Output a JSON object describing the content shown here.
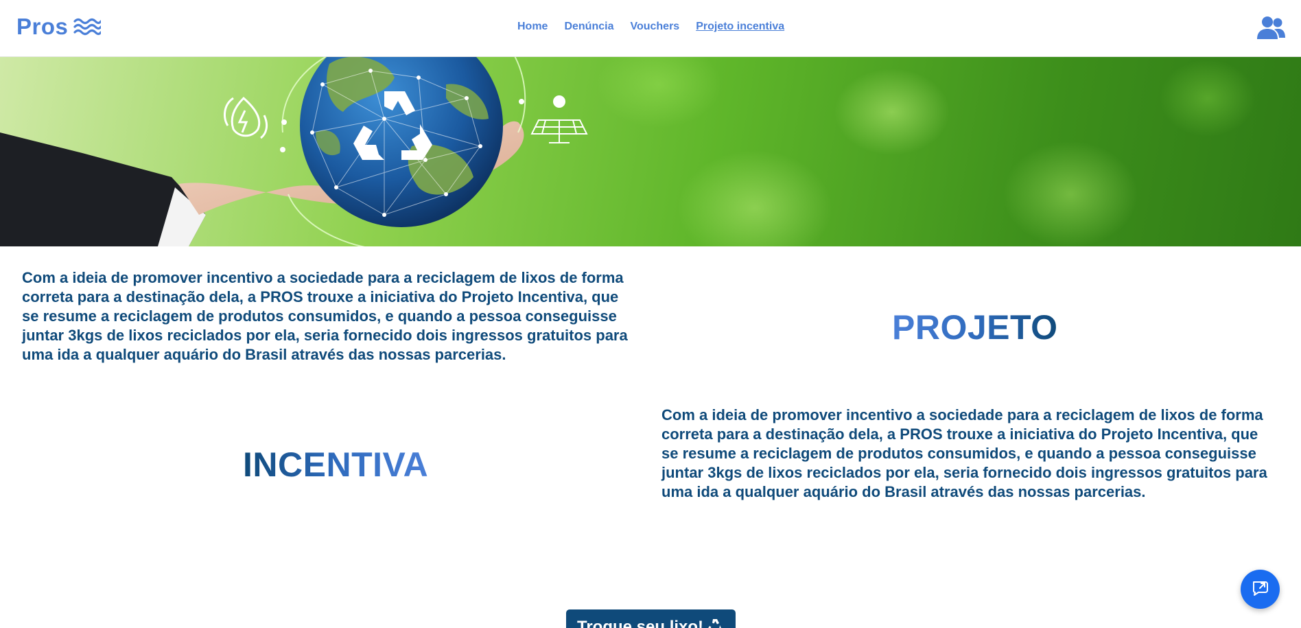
{
  "header": {
    "logo_text": "Pros",
    "logo_icon": "waves-icon",
    "nav": [
      {
        "label": "Home",
        "active": false
      },
      {
        "label": "Denúncia",
        "active": false
      },
      {
        "label": "Vouchers",
        "active": false
      },
      {
        "label": "Projeto incentiva",
        "active": true
      }
    ],
    "account_icon": "users-icon"
  },
  "hero": {
    "image_description_icons": [
      "recycle-icon",
      "energy-drop-icon",
      "solar-panel-icon"
    ]
  },
  "content": {
    "paragraph_left": "Com a ideia de promover incentivo a sociedade para a reciclagem de lixos de forma correta para a destinação dela, a PROS trouxe a iniciativa do Projeto Incentiva, que se resume a reciclagem de produtos consumidos, e quando a pessoa conseguisse juntar 3kgs de lixos reciclados por ela, seria fornecido dois ingressos gratuitos para uma ida a qualquer aquário do Brasil através das nossas parcerias.",
    "word_right": "PROJETO",
    "paragraph_right": "Com a ideia de promover incentivo a sociedade para a reciclagem de lixos de forma correta para a destinação dela, a PROS trouxe a iniciativa do Projeto Incentiva, que se resume a reciclagem de produtos consumidos, e quando a pessoa conseguisse juntar 3kgs de lixos reciclados por ela, seria fornecido dois ingressos gratuitos para uma ida a qualquer aquário do Brasil através das nossas parcerias.",
    "word_left": "INCENTIVA",
    "cta_label": "Troque seu lixo!"
  },
  "colors": {
    "brand": "#4a7fd8",
    "text_dark": "#0f4a7a",
    "fab": "#1a6cf0"
  },
  "chat_fab_icon": "chat-icon"
}
